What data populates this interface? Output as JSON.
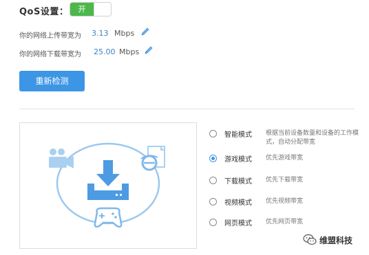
{
  "qos": {
    "label": "QoS设置：",
    "toggle_label": "开"
  },
  "bandwidth": {
    "upload_label": "你的网络上传带宽为",
    "upload_value": "3.13",
    "upload_unit": "Mbps",
    "download_label": "你的网络下载带宽为",
    "download_value": "25.00",
    "download_unit": "Mbps"
  },
  "actions": {
    "redetect_label": "重新检测"
  },
  "modes": [
    {
      "name": "智能模式",
      "desc": "根据当前设备数量和设备的工作模式，自动分配带宽",
      "selected": false
    },
    {
      "name": "游戏模式",
      "desc": "优先游戏带宽",
      "selected": true
    },
    {
      "name": "下载模式",
      "desc": "优先下载带宽",
      "selected": false
    },
    {
      "name": "视频模式",
      "desc": "优先视频带宽",
      "selected": false
    },
    {
      "name": "网页模式",
      "desc": "优先网页带宽",
      "selected": false
    }
  ],
  "watermark": {
    "text": "维盟科技"
  },
  "colors": {
    "accent": "#3d95e6",
    "toggle_on": "#4cb84c",
    "value_blue": "#3b82c9",
    "illustration": "#9cc8ee"
  },
  "icons": {
    "edit": "pencil-icon",
    "video": "video-camera-icon",
    "browser": "browser-ie-icon",
    "download": "download-icon",
    "game": "gamepad-icon",
    "watermark": "wechat-icon"
  }
}
